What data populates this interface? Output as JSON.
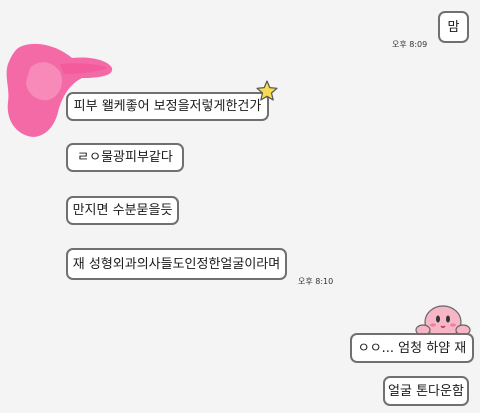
{
  "chat": {
    "sent_top": {
      "text": "맘",
      "time": "오후 8:09"
    },
    "received": [
      {
        "text": "피부 왤케좋어 보정을저렇게한건가"
      },
      {
        "text": "ㄹㅇ물광피부같다"
      },
      {
        "text": "만지면 수분묻을듯"
      },
      {
        "text": "재 성형외과의사들도인정한얼굴이라며"
      }
    ],
    "received_time": "오후 8:10",
    "sent_bottom": [
      {
        "text": "ㅇㅇ... 엄청 하얌 재"
      },
      {
        "text": "얼굴 톤다운함"
      }
    ]
  },
  "colors": {
    "background": "#f4f4f4",
    "bubble_fill": "#ffffff",
    "bubble_border": "#707070",
    "avatar_scribble": "#f46aa6",
    "star": "#f7dc52",
    "kirby_body": "#f6b6c6"
  },
  "icons": {
    "avatar": "pink-scribble-avatar",
    "decoration_star": "star-sticker",
    "decoration_character": "kirby-sticker"
  }
}
